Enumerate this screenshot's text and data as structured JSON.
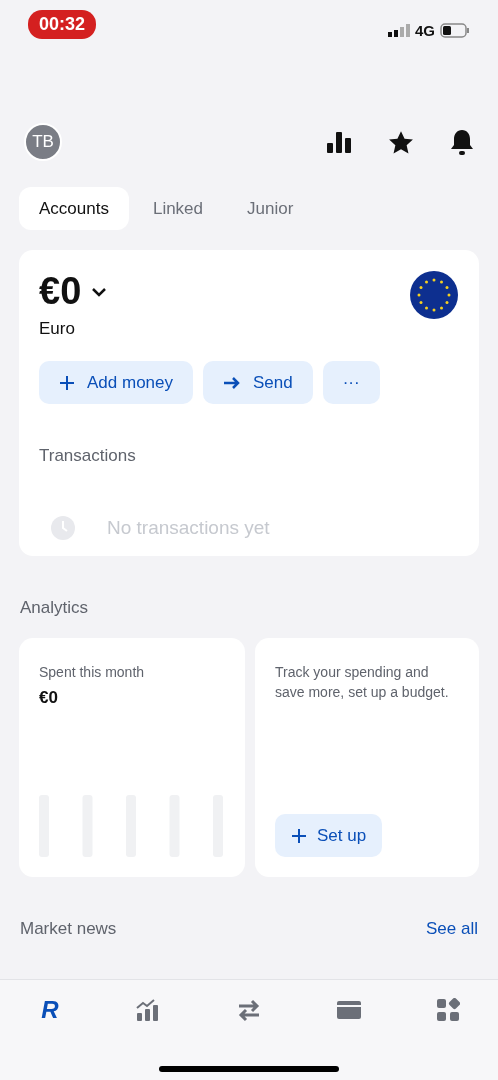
{
  "status_bar": {
    "time": "00:32",
    "network": "4G"
  },
  "header": {
    "avatar": "TB"
  },
  "tabs": [
    {
      "label": "Accounts",
      "selected": true
    },
    {
      "label": "Linked",
      "selected": false
    },
    {
      "label": "Junior",
      "selected": false
    }
  ],
  "account": {
    "balance": "€0",
    "currency": "Euro",
    "actions": [
      {
        "kind": "add",
        "label": "Add money"
      },
      {
        "kind": "send",
        "label": "Send"
      },
      {
        "kind": "more",
        "label": "···"
      }
    ],
    "transactions_title": "Transactions",
    "empty_text": "No transactions yet"
  },
  "analytics": {
    "title": "Analytics",
    "spent_label": "Spent this month",
    "spent_value": "€0",
    "budget_text": "Track your spending and save more, set up a budget.",
    "budget_button": "Set up"
  },
  "market_news": {
    "title": "Market news",
    "link": "See all"
  },
  "nav": [
    {
      "kind": "home",
      "label": "R",
      "selected": true
    },
    {
      "kind": "invest",
      "selected": false
    },
    {
      "kind": "transfer",
      "selected": false
    },
    {
      "kind": "card",
      "selected": false
    },
    {
      "kind": "hub",
      "selected": false
    }
  ]
}
